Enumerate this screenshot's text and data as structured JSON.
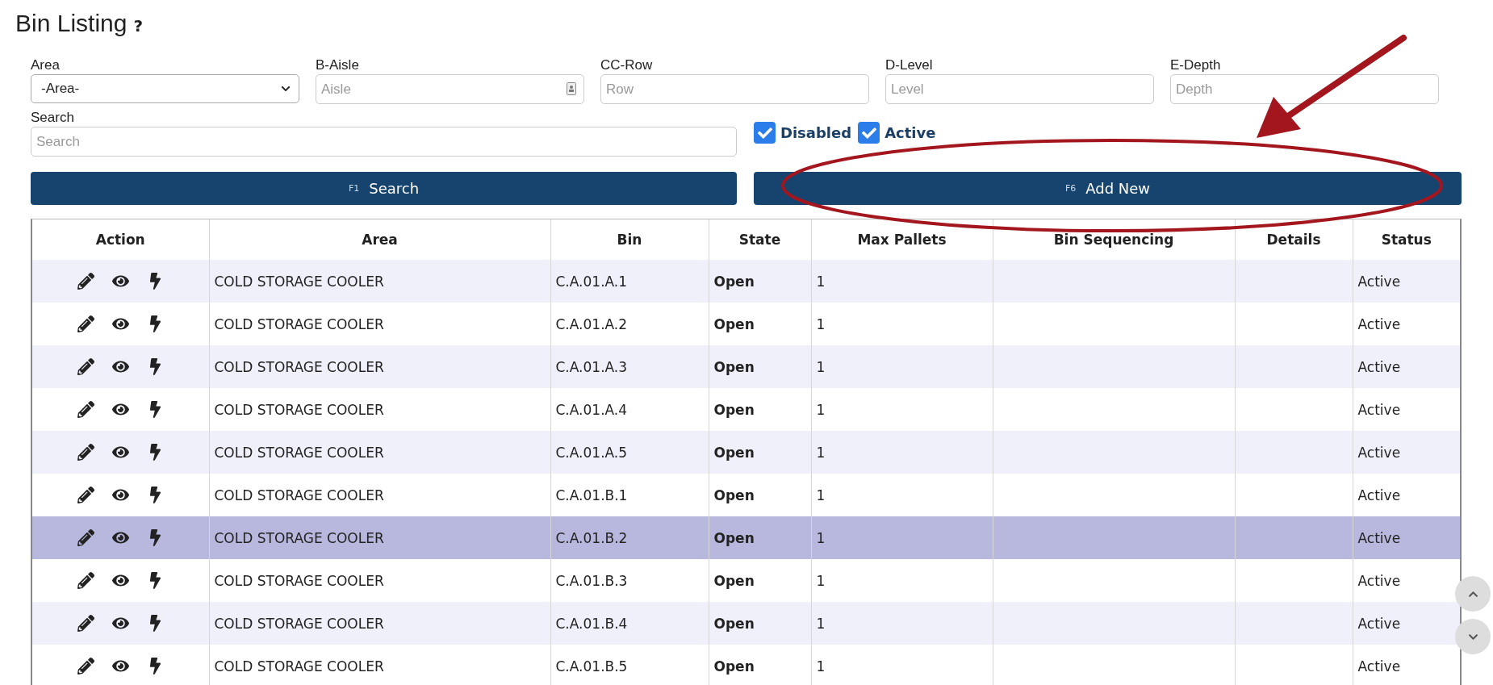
{
  "page": {
    "title": "Bin Listing",
    "help_mark": "?"
  },
  "filters": [
    {
      "label": "Area",
      "kind": "select",
      "value": "-Area-"
    },
    {
      "label": "B-Aisle",
      "kind": "text",
      "placeholder": "Aisle",
      "autofill_icon": true
    },
    {
      "label": "CC-Row",
      "kind": "text",
      "placeholder": "Row"
    },
    {
      "label": "D-Level",
      "kind": "text",
      "placeholder": "Level"
    },
    {
      "label": "E-Depth",
      "kind": "text",
      "placeholder": "Depth"
    }
  ],
  "search": {
    "label": "Search",
    "placeholder": "Search"
  },
  "checkboxes": [
    {
      "label": "Disabled",
      "checked": true
    },
    {
      "label": "Active",
      "checked": true
    }
  ],
  "buttons": [
    {
      "hotkey": "F1",
      "label": "Search"
    },
    {
      "hotkey": "F6",
      "label": "Add New"
    }
  ],
  "table": {
    "columns": [
      "Action",
      "Area",
      "Bin",
      "State",
      "Max Pallets",
      "Bin Sequencing",
      "Details",
      "Status"
    ],
    "rows": [
      {
        "area": "COLD STORAGE COOLER",
        "bin": "C.A.01.A.1",
        "state": "Open",
        "max_pallets": "1",
        "status": "Active",
        "selected": false
      },
      {
        "area": "COLD STORAGE COOLER",
        "bin": "C.A.01.A.2",
        "state": "Open",
        "max_pallets": "1",
        "status": "Active",
        "selected": false
      },
      {
        "area": "COLD STORAGE COOLER",
        "bin": "C.A.01.A.3",
        "state": "Open",
        "max_pallets": "1",
        "status": "Active",
        "selected": false
      },
      {
        "area": "COLD STORAGE COOLER",
        "bin": "C.A.01.A.4",
        "state": "Open",
        "max_pallets": "1",
        "status": "Active",
        "selected": false
      },
      {
        "area": "COLD STORAGE COOLER",
        "bin": "C.A.01.A.5",
        "state": "Open",
        "max_pallets": "1",
        "status": "Active",
        "selected": false
      },
      {
        "area": "COLD STORAGE COOLER",
        "bin": "C.A.01.B.1",
        "state": "Open",
        "max_pallets": "1",
        "status": "Active",
        "selected": false
      },
      {
        "area": "COLD STORAGE COOLER",
        "bin": "C.A.01.B.2",
        "state": "Open",
        "max_pallets": "1",
        "status": "Active",
        "selected": true
      },
      {
        "area": "COLD STORAGE COOLER",
        "bin": "C.A.01.B.3",
        "state": "Open",
        "max_pallets": "1",
        "status": "Active",
        "selected": false
      },
      {
        "area": "COLD STORAGE COOLER",
        "bin": "C.A.01.B.4",
        "state": "Open",
        "max_pallets": "1",
        "status": "Active",
        "selected": false
      },
      {
        "area": "COLD STORAGE COOLER",
        "bin": "C.A.01.B.5",
        "state": "Open",
        "max_pallets": "1",
        "status": "Active",
        "selected": false
      }
    ]
  },
  "annotation": {
    "arrow": true,
    "ellipse": true
  }
}
